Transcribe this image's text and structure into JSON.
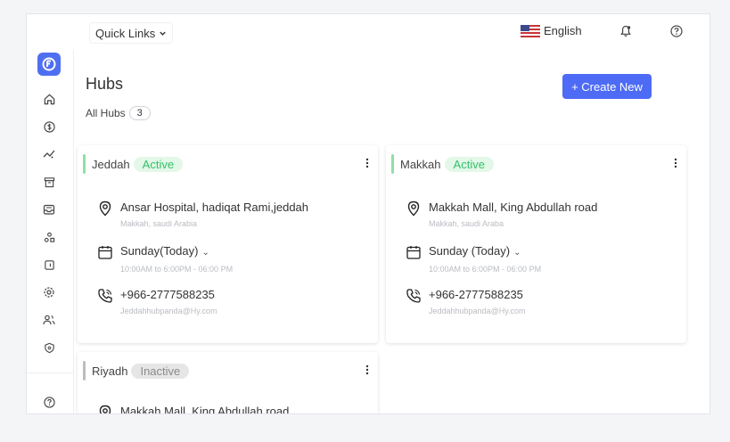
{
  "topbar": {
    "quick_links_label": "Quick Links",
    "language_label": "English"
  },
  "icons": {
    "logo": "app-logo",
    "sidebar": [
      "home-icon",
      "dollar-icon",
      "analytics-icon",
      "archive-icon",
      "inbox-icon",
      "shapes-icon",
      "wallet-icon",
      "settings-icon",
      "users-icon",
      "shield-icon",
      "help-icon"
    ]
  },
  "page": {
    "title": "Hubs",
    "all_hubs_label": "All Hubs",
    "all_hubs_count": "3",
    "create_button": "+ Create New"
  },
  "colors": {
    "accent": "#4d6bf5",
    "active_bar": "#8fe0a6",
    "inactive_bar": "#bdbdbd"
  },
  "hubs": [
    {
      "name": "Jeddah",
      "status": "Active",
      "address": "Ansar Hospital, hadiqat Rami,jeddah",
      "region": "Makkah, saudi Arabia",
      "day": "Sunday(Today)",
      "hours": "10:00AM to 6:00PM - 06:00 PM",
      "phone": "+966-2777588235",
      "email": "Jeddahhubpanda@Hy.com"
    },
    {
      "name": "Makkah",
      "status": "Active",
      "address": "Makkah Mall, King Abdullah road",
      "region": "Makkah, saudi Araba",
      "day": "Sunday (Today)",
      "hours": "10:00AM to 6:00PM - 06:00 PM",
      "phone": "+966-2777588235",
      "email": "Jeddahhubpanda@Hy.com"
    },
    {
      "name": "Riyadh",
      "status": "Inactive",
      "address": "Makkah Mall, King Abdullah road"
    }
  ]
}
